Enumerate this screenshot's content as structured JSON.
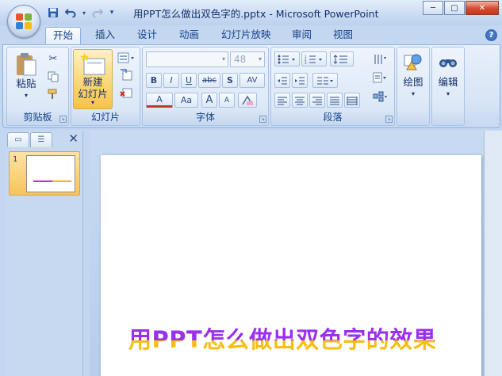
{
  "window": {
    "title": "用PPT怎么做出双色字的.pptx - Microsoft PowerPoint",
    "controls": [
      "─",
      "□",
      "✕"
    ]
  },
  "quick_access": {
    "save_icon": "save-icon",
    "undo_icon": "undo-icon",
    "redo_icon": "redo-icon"
  },
  "tabs": [
    {
      "label": "开始",
      "active": true
    },
    {
      "label": "插入"
    },
    {
      "label": "设计"
    },
    {
      "label": "动画"
    },
    {
      "label": "幻灯片放映"
    },
    {
      "label": "审阅"
    },
    {
      "label": "视图"
    }
  ],
  "help_label": "?",
  "ribbon": {
    "clipboard": {
      "label": "剪贴板",
      "paste": "粘贴"
    },
    "slides": {
      "label": "幻灯片",
      "new_slide_line1": "新建",
      "new_slide_line2": "幻灯片"
    },
    "font": {
      "label": "字体",
      "font_size": "48",
      "bold": "B",
      "italic": "I",
      "underline": "U",
      "strike": "abc",
      "shadow": "S",
      "spacing": "AV",
      "color": "A",
      "case": "Aa",
      "grow": "A",
      "shrink": "A"
    },
    "paragraph": {
      "label": "段落"
    },
    "drawing": {
      "label": "绘图"
    },
    "editing": {
      "label": "编辑"
    }
  },
  "slides_pane": {
    "slide_number": "1"
  },
  "slide": {
    "title": "用PPT怎么做出双色字的效果",
    "title_colors": {
      "top": "#9b2ff0",
      "bottom": "#f7bd0f"
    }
  }
}
